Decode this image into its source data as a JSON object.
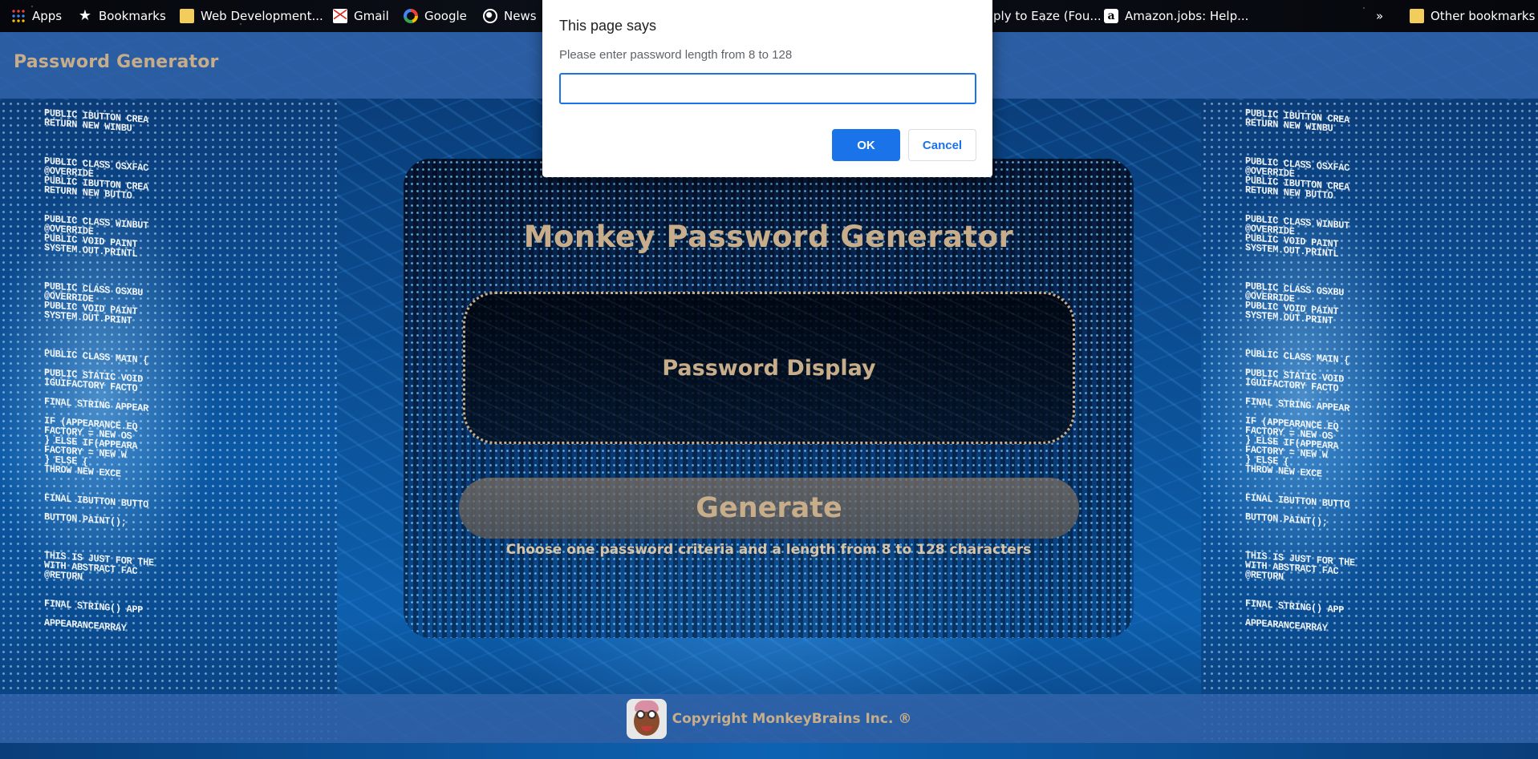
{
  "bookmarks_bar": {
    "apps": "Apps",
    "bookmarks": "Bookmarks",
    "web_development": "Web Development...",
    "gmail": "Gmail",
    "google": "Google",
    "news": "News",
    "apply_eaze": "ply to Eaze (Fou...",
    "amazon_jobs": "Amazon.jobs: Help...",
    "overflow": "»",
    "other_bookmarks": "Other bookmarks"
  },
  "header": {
    "title": "Password Generator"
  },
  "card": {
    "title": "Monkey Password Generator",
    "password_display": "Password Display",
    "generate_label": "Generate",
    "hint": "Choose one password criteria and a length from 8 to 128 characters"
  },
  "footer": {
    "copyright": "Copyright MonkeyBrains Inc. ®"
  },
  "dialog": {
    "title": "This page says",
    "message": "Please enter password length from 8 to 128",
    "input_value": "",
    "ok_label": "OK",
    "cancel_label": "Cancel"
  },
  "background_code": {
    "lines": [
      "PUBLIC IBUTTON CREA",
      "RETURN NEW WINBU",
      "",
      "",
      "",
      "PUBLIC CLASS OSXFAC",
      "@OVERRIDE",
      "PUBLIC IBUTTON CREA",
      "RETURN NEW BUTTO",
      "",
      "",
      "PUBLIC CLASS WINBUT",
      "@OVERRIDE",
      "PUBLIC VOID PAINT",
      "SYSTEM.OUT.PRINTL",
      "",
      "",
      "",
      "PUBLIC CLASS OSXBU",
      "@OVERRIDE",
      "PUBLIC VOID PAINT",
      "SYSTEM.OUT.PRINT",
      "",
      "",
      "",
      "PUBLIC CLASS MAIN {",
      "",
      "PUBLIC STATIC VOID",
      "IGUIFACTORY FACTO",
      "",
      "FINAL STRING APPEAR",
      "",
      "IF (APPEARANCE.EQ",
      "FACTORY = NEW OS",
      "} ELSE IF(APPEARA",
      "FACTORY = NEW W",
      "} ELSE {",
      "THROW NEW EXCE",
      "",
      "",
      "FINAL IBUTTON BUTTO",
      "",
      "BUTTON.PAINT();",
      "",
      "",
      "",
      "THIS IS JUST FOR THE",
      "WITH ABSTRACT FAC",
      "@RETURN",
      "",
      "",
      "FINAL STRING() APP",
      "",
      "APPEARANCEARRAY"
    ]
  },
  "colors": {
    "accent_gold": "#c8ad8a",
    "header_blue": "#3062a8",
    "dialog_button_blue": "#1a73e8"
  }
}
